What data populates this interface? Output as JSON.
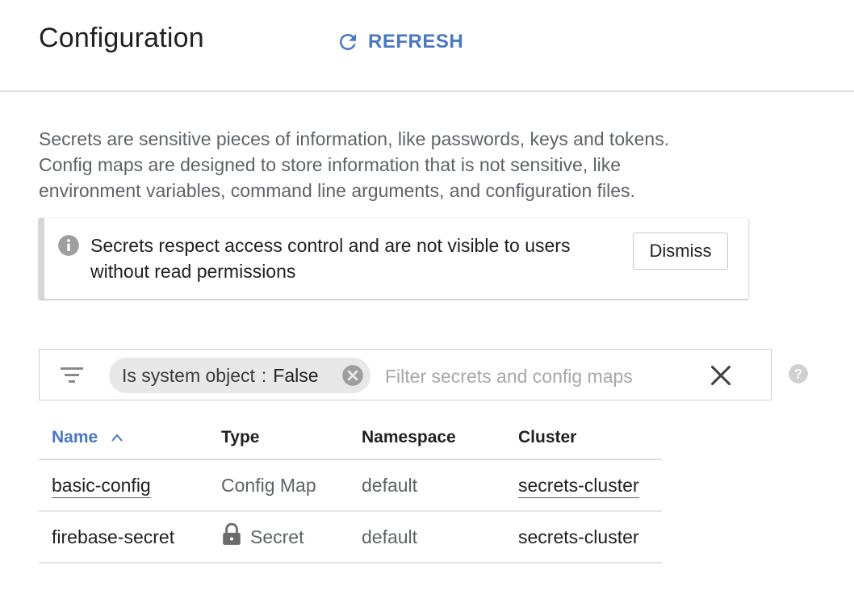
{
  "header": {
    "title": "Configuration",
    "refresh_label": "REFRESH"
  },
  "description": {
    "line1": "Secrets are sensitive pieces of information, like passwords, keys and tokens.",
    "line2": "Config maps are designed to store information that is not sensitive, like",
    "line3": "environment variables, command line arguments, and configuration files."
  },
  "notice": {
    "line1": "Secrets respect access control and are not visible to users",
    "line2": "without read permissions",
    "dismiss_label": "Dismiss"
  },
  "filter": {
    "chip_key": "Is system object",
    "chip_separator": ":",
    "chip_value": "False",
    "placeholder": "Filter secrets and config maps"
  },
  "table": {
    "columns": [
      "Name",
      "Type",
      "Namespace",
      "Cluster"
    ],
    "sort": {
      "column": "Name",
      "direction": "ascending"
    },
    "rows": [
      {
        "name": "basic-config",
        "type": "Config Map",
        "namespace": "default",
        "cluster": "secrets-cluster"
      },
      {
        "name": "firebase-secret",
        "type": "Secret",
        "namespace": "default",
        "cluster": "secrets-cluster"
      }
    ]
  },
  "icons": {
    "refresh": "refresh-icon",
    "info": "info-icon",
    "filter": "filter-icon",
    "chip_remove": "close-circle-icon",
    "clear": "close-icon",
    "help": "help-icon",
    "sort": "chevron-up-icon",
    "lock": "lock-icon"
  },
  "colors": {
    "accent": "#4a78c2",
    "text_primary": "#212121",
    "text_secondary": "#5f6368",
    "chip_bg": "#e8e8e8",
    "notice_bar": "#d6d6d6"
  }
}
